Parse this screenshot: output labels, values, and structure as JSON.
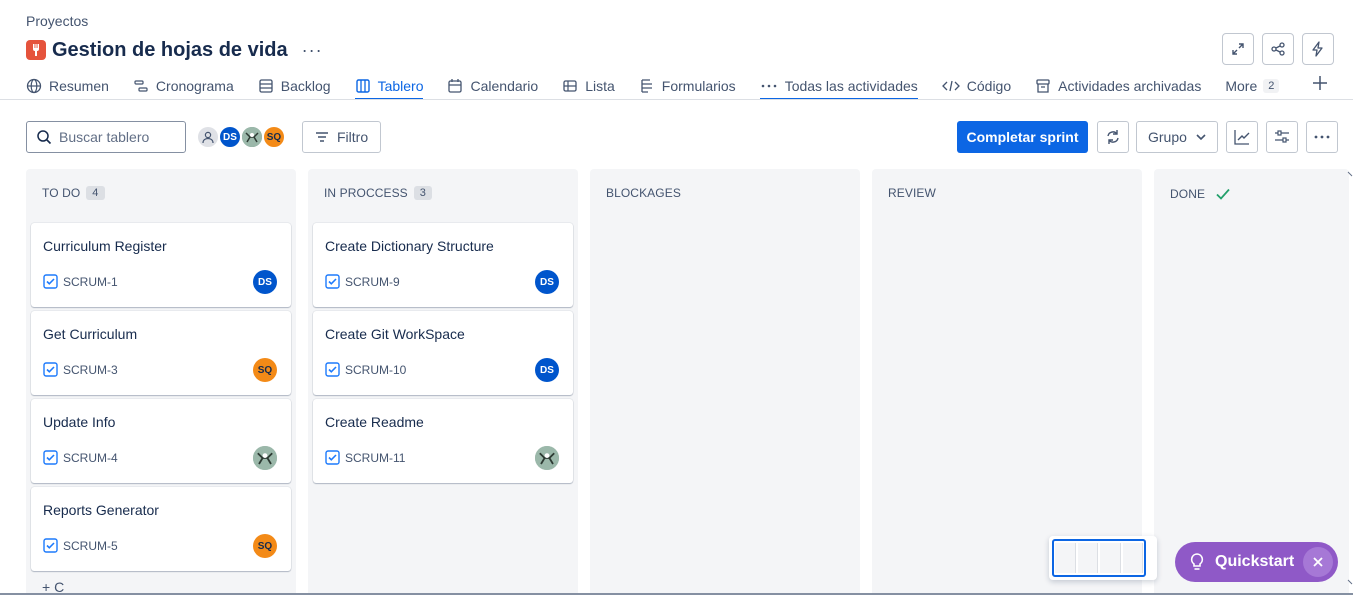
{
  "breadcrumb": "Proyectos",
  "project": {
    "title": "Gestion de hojas de vida",
    "more": "···"
  },
  "tabs": [
    {
      "label": "Resumen",
      "icon": "globe-icon"
    },
    {
      "label": "Cronograma",
      "icon": "timeline-icon"
    },
    {
      "label": "Backlog",
      "icon": "backlog-icon"
    },
    {
      "label": "Tablero",
      "icon": "board-icon",
      "active": true
    },
    {
      "label": "Calendario",
      "icon": "calendar-icon"
    },
    {
      "label": "Lista",
      "icon": "list-icon"
    },
    {
      "label": "Formularios",
      "icon": "forms-icon"
    },
    {
      "label": "Todas las actividades",
      "icon": "dots-icon"
    },
    {
      "label": "Código",
      "icon": "code-icon"
    },
    {
      "label": "Actividades archivadas",
      "icon": "archive-icon"
    },
    {
      "label": "More",
      "badge": "2"
    }
  ],
  "toolbar": {
    "search_placeholder": "Buscar tablero",
    "avatars": [
      "DS",
      "SQ"
    ],
    "filter_label": "Filtro",
    "complete_sprint": "Completar sprint",
    "group_label": "Grupo"
  },
  "columns": [
    {
      "name": "TO DO",
      "count": "4",
      "cards": [
        {
          "title": "Curriculum Register",
          "key": "SCRUM-1",
          "assignee": "DS"
        },
        {
          "title": "Get Curriculum",
          "key": "SCRUM-3",
          "assignee": "SQ"
        },
        {
          "title": "Update Info",
          "key": "SCRUM-4",
          "assignee": ""
        },
        {
          "title": "Reports Generator",
          "key": "SCRUM-5",
          "assignee": "SQ"
        }
      ],
      "create_label": "+ C"
    },
    {
      "name": "IN PROCCESS",
      "count": "3",
      "cards": [
        {
          "title": "Create Dictionary Structure",
          "key": "SCRUM-9",
          "assignee": "DS"
        },
        {
          "title": "Create Git WorkSpace",
          "key": "SCRUM-10",
          "assignee": "DS"
        },
        {
          "title": "Create Readme",
          "key": "SCRUM-11",
          "assignee": ""
        }
      ]
    },
    {
      "name": "BLOCKAGES",
      "cards": []
    },
    {
      "name": "REVIEW",
      "cards": []
    },
    {
      "name": "DONE",
      "cards": []
    }
  ],
  "quickstart": {
    "label": "Quickstart"
  },
  "colors": {
    "accent": "#0c66e4",
    "quickstart": "#8f59c7",
    "avatar_blue": "#0055cc",
    "avatar_orange": "#f38a17"
  }
}
